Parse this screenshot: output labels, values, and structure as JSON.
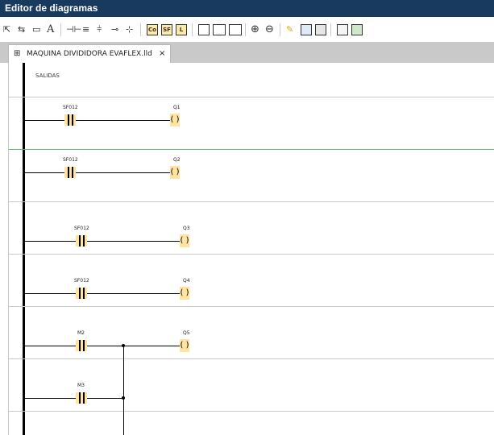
{
  "window": {
    "title": "Editor de diagramas"
  },
  "toolbar": {
    "tools": [
      {
        "name": "select-tool-icon",
        "glyph": "⇱"
      },
      {
        "name": "connect-tool-icon",
        "glyph": "⇆"
      },
      {
        "name": "block-tool-icon",
        "glyph": "▭"
      },
      {
        "name": "text-tool-icon",
        "glyph": "A"
      },
      {
        "name": "contact-tool-icon",
        "glyph": "⊣⊢"
      },
      {
        "name": "parallel-tool-icon",
        "glyph": "≡"
      },
      {
        "name": "branch-tool-icon",
        "glyph": "⫩"
      },
      {
        "name": "coil-tool-icon",
        "glyph": "⊸"
      },
      {
        "name": "coil-set-tool-icon",
        "glyph": "⊹"
      }
    ],
    "labeled_tools": [
      {
        "name": "co-tool-icon",
        "label": "Co"
      },
      {
        "name": "sf-tool-icon",
        "label": "SF"
      },
      {
        "name": "l-tool-icon",
        "label": "L"
      }
    ],
    "zoom_in_icon": "⊕",
    "zoom_out_icon": "⊖",
    "pencil_icon": "✎"
  },
  "tab": {
    "icon": "⊞",
    "label": "MAQUINA DIVIDIDORA EVAFLEX.lld",
    "close": "×"
  },
  "diagram": {
    "section_label": "SALIDAS",
    "rungs": [
      {
        "contact": "SF012",
        "coil": "Q1"
      },
      {
        "contact": "SF012",
        "coil": "Q2"
      },
      {
        "contact": "SF012",
        "coil": "Q3"
      },
      {
        "contact": "SF012",
        "coil": "Q4"
      },
      {
        "contact": "M2",
        "coil": "Q5"
      },
      {
        "contact": "M3",
        "coil": ""
      }
    ],
    "coil_glyph": "( )"
  }
}
